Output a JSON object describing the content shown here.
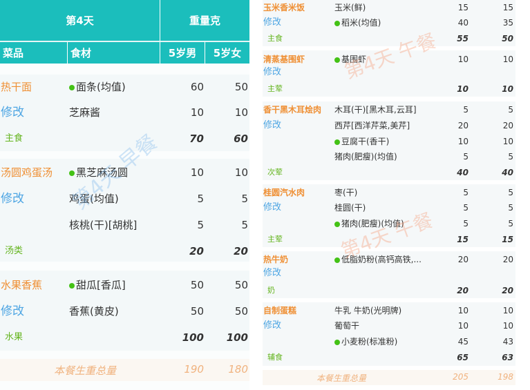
{
  "breakfast": {
    "header": {
      "day": "第4天",
      "weight": "重量克",
      "col_dish": "菜品",
      "col_food": "食材",
      "col_m": "5岁男",
      "col_f": "5岁女"
    },
    "groups": [
      {
        "dish": "热干面",
        "edit": "修改",
        "category": "主食",
        "total_m": "70",
        "total_f": "60",
        "items": [
          {
            "name": "面条(均值)",
            "dot": true,
            "m": "60",
            "f": "50"
          },
          {
            "name": "芝麻酱",
            "dot": false,
            "m": "10",
            "f": "10"
          }
        ]
      },
      {
        "dish": "汤圆鸡蛋汤",
        "edit": "修改",
        "category": "汤类",
        "total_m": "20",
        "total_f": "20",
        "items": [
          {
            "name": "黑芝麻汤圆",
            "dot": true,
            "m": "10",
            "f": "10"
          },
          {
            "name": "鸡蛋(均值)",
            "dot": false,
            "m": "5",
            "f": "5"
          },
          {
            "name": "核桃(干)[胡桃]",
            "dot": false,
            "m": "5",
            "f": "5"
          }
        ]
      },
      {
        "dish": "水果香蕉",
        "edit": "修改",
        "category": "水果",
        "total_m": "100",
        "total_f": "100",
        "items": [
          {
            "name": "甜瓜[香瓜]",
            "dot": true,
            "m": "50",
            "f": "50"
          },
          {
            "name": "香蕉(黄皮)",
            "dot": false,
            "m": "50",
            "f": "50"
          }
        ]
      }
    ],
    "summary": {
      "label": "本餐生重总量",
      "m": "190",
      "f": "180"
    },
    "watermark": "第4天 早餐"
  },
  "lunch": {
    "groups": [
      {
        "dish": "玉米香米饭",
        "edit": "修改",
        "category": "主食",
        "total_m": "55",
        "total_f": "50",
        "items": [
          {
            "name": "玉米(鲜)",
            "dot": false,
            "m": "15",
            "f": "15"
          },
          {
            "name": "稻米(均值)",
            "dot": true,
            "m": "40",
            "f": "35"
          }
        ]
      },
      {
        "dish": "清蒸基围虾",
        "edit": "修改",
        "category": "主荤",
        "total_m": "10",
        "total_f": "10",
        "items": [
          {
            "name": "基围虾",
            "dot": true,
            "m": "10",
            "f": "10"
          }
        ]
      },
      {
        "dish": "香干黑木耳烩肉",
        "edit": "修改",
        "category": "次荤",
        "total_m": "40",
        "total_f": "40",
        "items": [
          {
            "name": "木耳(干)[黑木耳,云耳]",
            "dot": false,
            "m": "5",
            "f": "5"
          },
          {
            "name": "西芹[西洋芹菜,美芹]",
            "dot": false,
            "m": "20",
            "f": "20"
          },
          {
            "name": "豆腐干(香干)",
            "dot": true,
            "m": "10",
            "f": "10"
          },
          {
            "name": "猪肉(肥瘦)(均值)",
            "dot": false,
            "m": "5",
            "f": "5"
          }
        ]
      },
      {
        "dish": "桂圆汽水肉",
        "edit": "修改",
        "category": "主荤",
        "total_m": "15",
        "total_f": "15",
        "items": [
          {
            "name": "枣(干)",
            "dot": false,
            "m": "5",
            "f": "5"
          },
          {
            "name": "桂圆(干)",
            "dot": false,
            "m": "5",
            "f": "5"
          },
          {
            "name": "猪肉(肥瘦)(均值)",
            "dot": true,
            "m": "5",
            "f": "5"
          }
        ]
      },
      {
        "dish": "热牛奶",
        "edit": "修改",
        "category": "奶",
        "total_m": "20",
        "total_f": "20",
        "items": [
          {
            "name": "低脂奶粉(高钙高铁,...",
            "dot": true,
            "m": "20",
            "f": "20"
          }
        ]
      },
      {
        "dish": "自制蛋糕",
        "edit": "修改",
        "category": "辅食",
        "total_m": "65",
        "total_f": "63",
        "items": [
          {
            "name": "牛乳 牛奶(光明牌)",
            "dot": false,
            "m": "10",
            "f": "10"
          },
          {
            "name": "葡萄干",
            "dot": false,
            "m": "10",
            "f": "10"
          },
          {
            "name": "小麦粉(标准粉)",
            "dot": true,
            "m": "45",
            "f": "43"
          }
        ]
      }
    ],
    "summary": {
      "label": "本餐生重总量",
      "m": "205",
      "f": "198"
    },
    "watermark": "第4天 午餐"
  },
  "colors": {
    "header_bg": "#1bbebc",
    "dish": "#ef8f34",
    "edit": "#4da5e3",
    "category": "#64b41e",
    "dot": "#44c216",
    "summary": "#f0b27e"
  }
}
